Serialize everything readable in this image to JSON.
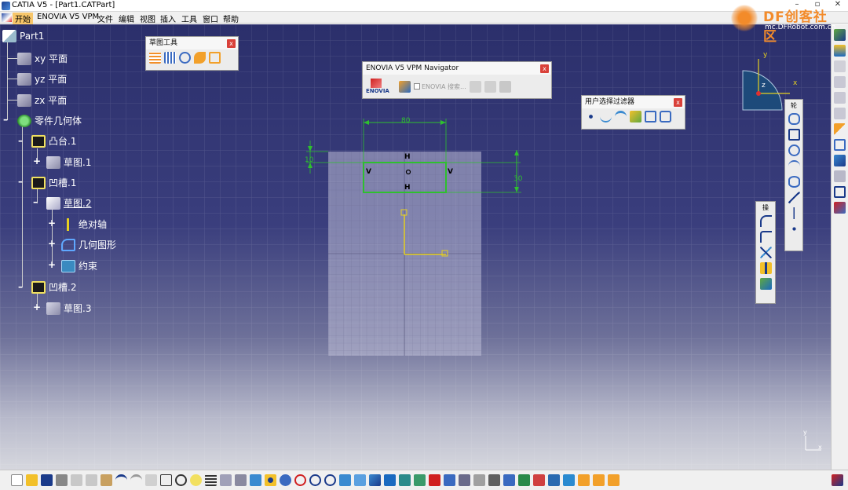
{
  "window": {
    "title": "CATIA V5 - [Part1.CATPart]"
  },
  "menu": {
    "items": [
      "开始",
      "ENOVIA V5 VPM",
      "文件",
      "编辑",
      "视图",
      "插入",
      "工具",
      "窗口",
      "帮助"
    ]
  },
  "watermark": {
    "name": "DF创客社区",
    "url": "mc.DFRobot.com.cn"
  },
  "tree": {
    "nodes": [
      {
        "label": "Part1",
        "icon": "part-icon"
      },
      {
        "label": "xy 平面",
        "icon": "plane-icon"
      },
      {
        "label": "yz 平面",
        "icon": "plane-icon"
      },
      {
        "label": "zx 平面",
        "icon": "plane-icon"
      },
      {
        "label": "零件几何体",
        "icon": "body-gear-icon"
      },
      {
        "label": "凸台.1",
        "icon": "pad-icon"
      },
      {
        "label": "草图.1",
        "icon": "sketch-icon"
      },
      {
        "label": "凹槽.1",
        "icon": "pocket-icon"
      },
      {
        "label": "草图.2",
        "icon": "sketch-edit-icon"
      },
      {
        "label": "绝对轴",
        "icon": "axis-icon"
      },
      {
        "label": "几何图形",
        "icon": "geometry-icon"
      },
      {
        "label": "约束",
        "icon": "constraint-icon"
      },
      {
        "label": "凹槽.2",
        "icon": "pocket-icon"
      },
      {
        "label": "草图.3",
        "icon": "sketch-icon"
      }
    ]
  },
  "toolbars": {
    "sketch_tools": {
      "title": "草图工具",
      "close": "x"
    },
    "enovia_navigator": {
      "title": "ENOVIA V5 VPM Navigator",
      "logo_text": "ENOVIA",
      "option_label": "ENOVIA 搜索...",
      "close": "x"
    },
    "user_filter": {
      "title": "用户选择过滤器",
      "close": "x"
    },
    "vertical_1_title": "轮",
    "vertical_2_title": "操"
  },
  "sketch": {
    "dim_width": "80",
    "dim_height": "30",
    "dim_offset": "10",
    "constraints": {
      "top": "H",
      "bottom": "H",
      "left": "V",
      "right": "V"
    }
  },
  "compass": {
    "axis_x": "x",
    "axis_y": "y",
    "axis_z": "z"
  },
  "viewport_axis": {
    "x": "x",
    "y": "y"
  },
  "colors": {
    "background_top": "#2b2f6b",
    "background_bottom": "#d6d7de",
    "sketch_green": "#2ec02e",
    "axis_yellow": "#e6d020",
    "accent_orange": "#f38b2a"
  }
}
